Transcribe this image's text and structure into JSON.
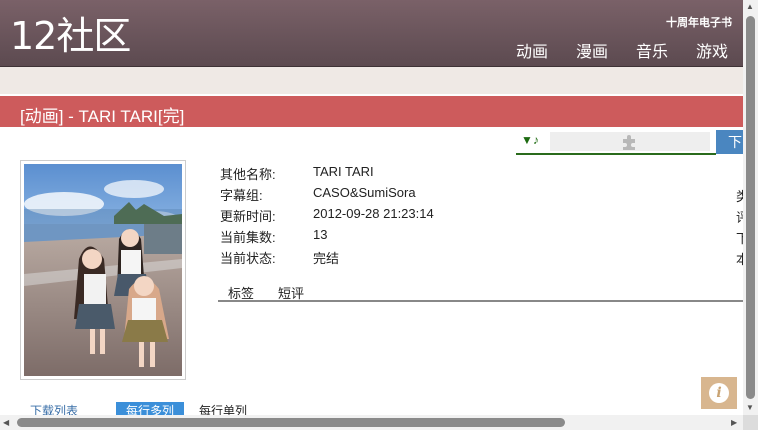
{
  "header": {
    "logo": "12社区",
    "anniversary": "十周年电子书",
    "nav": [
      "动画",
      "漫画",
      "音乐",
      "游戏"
    ]
  },
  "page": {
    "title": "[动画] - TARI TARI[完]",
    "download_tab": "下"
  },
  "player": {
    "note_icon": "▼♪"
  },
  "info": [
    {
      "label": "其他名称:",
      "value": "TARI TARI"
    },
    {
      "label": "字幕组:",
      "value": "CASO&SumiSora"
    },
    {
      "label": "更新时间:",
      "value": "2012-09-28 21:23:14"
    },
    {
      "label": "当前集数:",
      "value": "13"
    },
    {
      "label": "当前状态:",
      "value": "完结"
    }
  ],
  "right_clipped": [
    "类",
    "评",
    "下",
    "本"
  ],
  "tabs": [
    "标签",
    "短评"
  ],
  "bottom": {
    "download_list": "下载列表",
    "multi": "每行多列",
    "single": "每行单列"
  },
  "help_icon": "i",
  "colors": {
    "header": "#6b5459",
    "title_bar": "#cd5b5c",
    "accent_blue": "#3b8fd9"
  }
}
